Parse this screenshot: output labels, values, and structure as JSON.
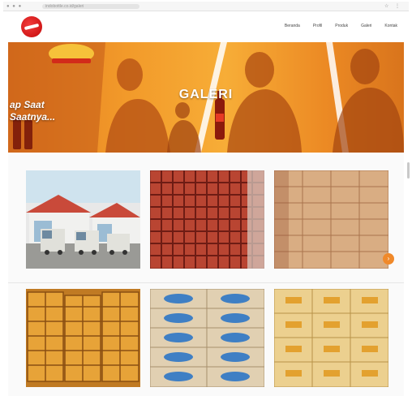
{
  "browser": {
    "window_controls": "● ● ●",
    "address": "indobottle.co.id/galeri",
    "tools": "☆ ⋮"
  },
  "header": {
    "logo_icon": "red-circle-logo",
    "nav": [
      {
        "label": "Beranda"
      },
      {
        "label": "Profil"
      },
      {
        "label": "Produk"
      },
      {
        "label": "Galeri"
      },
      {
        "label": "Kontak"
      }
    ]
  },
  "hero": {
    "title": "GALERI",
    "slogan": "ap Saat\nSaatnya..."
  },
  "gallery": {
    "items": [
      {
        "name": "truck-depot"
      },
      {
        "name": "red-crate-stack"
      },
      {
        "name": "carton-stack"
      },
      {
        "name": "yellow-crate-stack"
      },
      {
        "name": "blue-label-cartons"
      },
      {
        "name": "yellow-cartons"
      }
    ],
    "next_button_icon": "chevron-right-icon"
  },
  "colors": {
    "accent": "#f0892a",
    "brand_red": "#d21818",
    "hero_orange": "#f29a2a"
  }
}
